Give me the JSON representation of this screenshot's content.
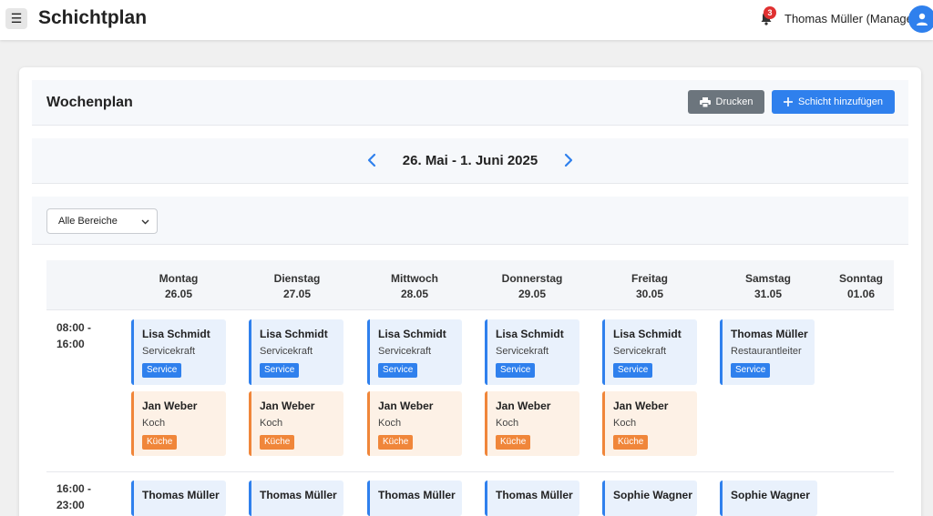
{
  "app": {
    "title": "Schichtplan",
    "menu_icon": "☰",
    "notification_count": "3",
    "user_name": "Thomas Müller (Manager)"
  },
  "plan": {
    "title": "Wochenplan",
    "print_label": "Drucken",
    "add_label": "Schicht hinzufügen",
    "week_range": "26. Mai - 1. Juni 2025",
    "filter_selected": "Alle Bereiche"
  },
  "days": [
    {
      "name": "Montag",
      "date": "26.05"
    },
    {
      "name": "Dienstag",
      "date": "27.05"
    },
    {
      "name": "Mittwoch",
      "date": "28.05"
    },
    {
      "name": "Donnerstag",
      "date": "29.05"
    },
    {
      "name": "Freitag",
      "date": "30.05"
    },
    {
      "name": "Samstag",
      "date": "31.05"
    },
    {
      "name": "Sonntag",
      "date": "01.06"
    }
  ],
  "time_slots": [
    {
      "start": "08:00 -",
      "end": "16:00"
    },
    {
      "start": "16:00 -",
      "end": "23:00"
    }
  ],
  "shifts": [
    {
      "name": "Lisa Schmidt",
      "role": "Servicekraft",
      "tag": "Service"
    },
    {
      "name": "Jan Weber",
      "role": "Koch",
      "tag": "Küche"
    },
    {
      "name": "Thomas Müller",
      "role": "Restaurantleiter",
      "tag": "Service"
    },
    {
      "name": "Sophie Wagner",
      "role": "",
      "tag": ""
    }
  ],
  "colors": {
    "accent": "#2f80ed",
    "kitchen": "#f0863a",
    "secondary_button": "#6c757d",
    "badge": "#e03131"
  }
}
